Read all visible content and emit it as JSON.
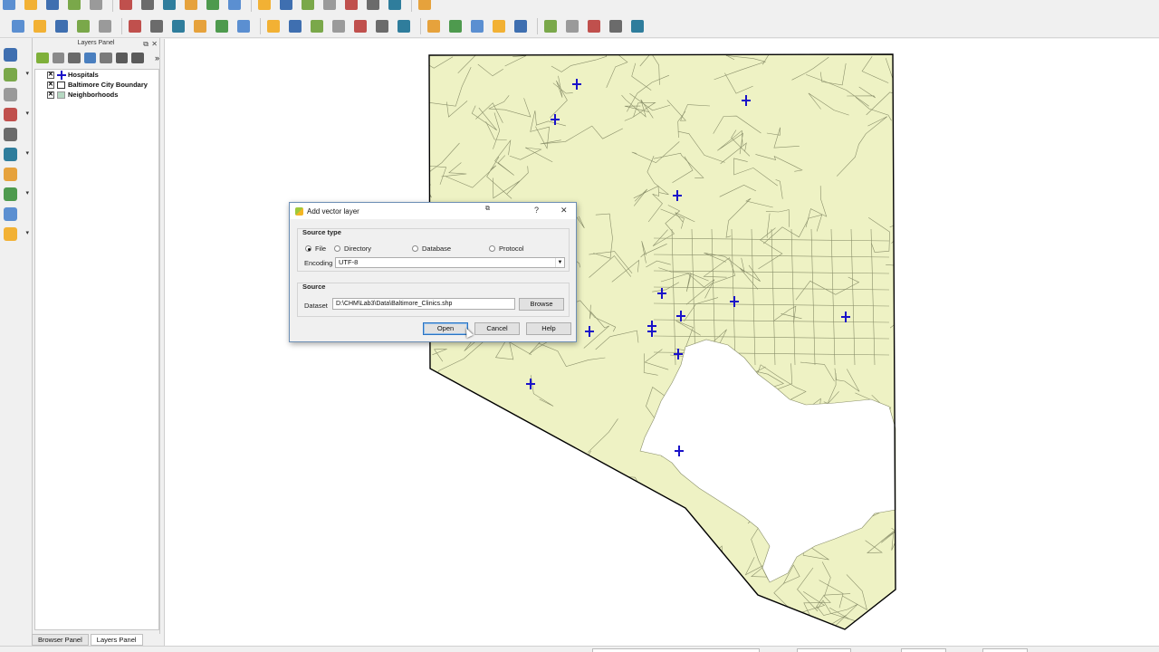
{
  "toolbar_top": {
    "icons": [
      "new-project-icon",
      "open-project-icon",
      "save-project-icon",
      "save-as-icon",
      "new-print-layout-icon",
      "composer-manager-icon",
      "pan-icon",
      "pan-to-selection-icon",
      "zoom-in-icon",
      "zoom-out-icon",
      "zoom-full-icon",
      "zoom-to-layer-icon",
      "zoom-last-icon",
      "zoom-next-icon",
      "refresh-icon",
      "python-console-icon",
      "plugin-icon",
      "processing-icon",
      "digitize-icon"
    ]
  },
  "toolbar_second": {
    "icons": [
      "edits-icon",
      "toggle-editing-icon",
      "save-edits-icon",
      "add-feature-icon",
      "move-feature-icon",
      "node-tool-icon",
      "delete-selected-icon",
      "cut-features-icon",
      "copy-features-icon",
      "paste-features-icon",
      "processing-toolbox-icon",
      "globe-icon",
      "web-service-icon",
      "plugin-a-icon",
      "plugin-b-icon",
      "plugin-c-icon",
      "plugin-d-icon",
      "plugin-e-icon",
      "identify-icon",
      "select-features-icon",
      "select-by-value-icon",
      "deselect-icon",
      "open-attribute-table-icon",
      "field-calculator-icon",
      "statistics-icon",
      "measure-icon",
      "map-tips-icon",
      "text-annotation-icon"
    ]
  },
  "left_toolbar": {
    "icons": [
      "add-vector-layer-icon",
      "add-raster-layer-icon",
      "add-delimited-text-icon",
      "add-spatialite-icon",
      "add-wms-icon",
      "add-wfs-icon",
      "add-wcs-icon",
      "add-virtual-layer-icon",
      "new-shapefile-icon",
      "add-mesh-icon"
    ]
  },
  "layers_panel": {
    "title": "Layers Panel",
    "layers": [
      {
        "name": "Hospitals",
        "symbol": "cross",
        "checked": true
      },
      {
        "name": "Baltimore City Boundary",
        "symbol": "box",
        "checked": true
      },
      {
        "name": "Neighborhoods",
        "symbol": "fill",
        "checked": true
      }
    ]
  },
  "bottom_tabs": [
    "Browser Panel",
    "Layers Panel"
  ],
  "map": {
    "polygon_fill": "#eef2c4",
    "boundary_color": "#000000",
    "line_color": "#8a8f6a",
    "point_color": "#1a12c9"
  },
  "dialog": {
    "title": "Add vector layer",
    "help_glyph": "?",
    "close_glyph": "✕",
    "source_type": {
      "label": "Source type",
      "options": [
        "File",
        "Directory",
        "Database",
        "Protocol"
      ],
      "selected": "File",
      "encoding_label": "Encoding",
      "encoding_value": "UTF-8"
    },
    "source": {
      "label": "Source",
      "dataset_label": "Dataset",
      "dataset_value": "D:\\CHM\\Lab3\\Data\\Baltimore_Clinics.shp",
      "browse_label": "Browse"
    },
    "buttons": {
      "open": "Open",
      "cancel": "Cancel",
      "help": "Help"
    }
  }
}
